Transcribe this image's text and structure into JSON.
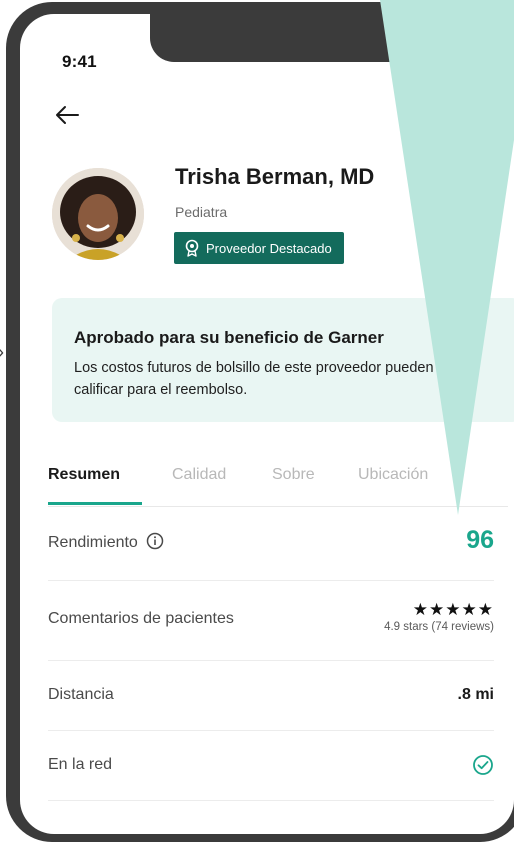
{
  "status_bar": {
    "time": "9:41"
  },
  "header": {
    "back_icon": "arrow-left-icon"
  },
  "provider": {
    "name": "Trisha Berman, MD",
    "specialty": "Pediatra",
    "badge_label": "Proveedor Destacado",
    "badge_icon": "award-ribbon-icon"
  },
  "benefit_card": {
    "title": "Aprobado para su beneficio de Garner",
    "body": "Los costos futuros de bolsillo de este proveedor pueden calificar para el reembolso."
  },
  "tabs": [
    {
      "label": "Resumen",
      "active": true
    },
    {
      "label": "Calidad",
      "active": false
    },
    {
      "label": "Sobre",
      "active": false
    },
    {
      "label": "Ubicación",
      "active": false
    }
  ],
  "rows": {
    "performance": {
      "label": "Rendimiento",
      "value": "96"
    },
    "reviews": {
      "label": "Comentarios de pacientes",
      "stars": "★★★★★",
      "summary": "4.9 stars (74 reviews)"
    },
    "distance": {
      "label": "Distancia",
      "value": ".8 mi"
    },
    "network": {
      "label": "En la red",
      "icon": "check-circle-icon"
    }
  },
  "colors": {
    "accent": "#1aa68c",
    "badge_bg": "#136b5c",
    "card_bg": "#e9f6f3",
    "overlay": "#b9e6dc",
    "phone_frame": "#3b3b3b"
  }
}
